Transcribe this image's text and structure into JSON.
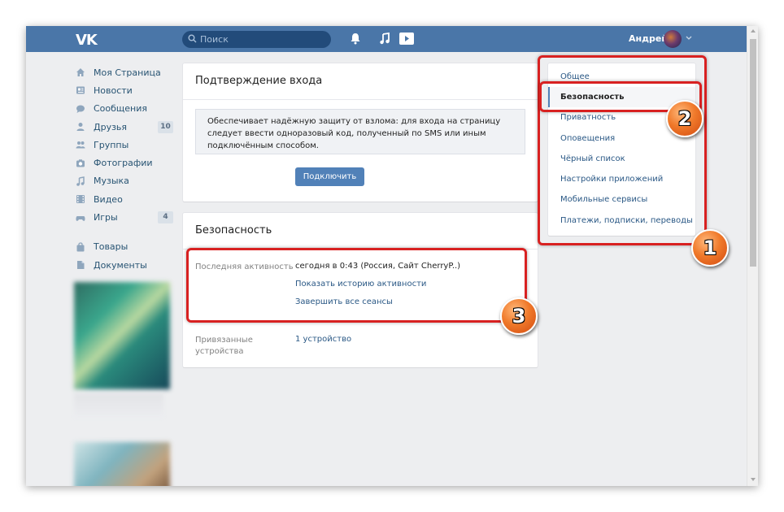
{
  "header": {
    "logo": "VK",
    "search_placeholder": "Поиск",
    "user_name": "Андрей"
  },
  "left_nav": [
    {
      "label": "Моя Страница",
      "icon": "home-icon"
    },
    {
      "label": "Новости",
      "icon": "news-icon"
    },
    {
      "label": "Сообщения",
      "icon": "messages-icon"
    },
    {
      "label": "Друзья",
      "icon": "friends-icon",
      "badge": "10"
    },
    {
      "label": "Группы",
      "icon": "groups-icon"
    },
    {
      "label": "Фотографии",
      "icon": "photos-icon"
    },
    {
      "label": "Музыка",
      "icon": "music-icon"
    },
    {
      "label": "Видео",
      "icon": "video-icon"
    },
    {
      "label": "Игры",
      "icon": "games-icon",
      "badge": "4"
    },
    {
      "label": "Товары",
      "icon": "market-icon"
    },
    {
      "label": "Документы",
      "icon": "documents-icon"
    }
  ],
  "login_confirmation": {
    "title": "Подтверждение входа",
    "description": "Обеспечивает надёжную защиту от взлома: для входа на страницу следует ввести одноразовый код, полученный по SMS или иным подключённым способом.",
    "connect_button": "Подключить"
  },
  "security": {
    "title": "Безопасность",
    "last_activity_label": "Последняя активность",
    "last_activity_value": "сегодня в 0:43 (Россия, Сайт CherryP..)",
    "show_history_link": "Показать историю активности",
    "end_sessions_link": "Завершить все сеансы",
    "devices_label": "Привязанные устройства",
    "devices_value": "1 устройство"
  },
  "settings_menu": [
    {
      "label": "Общее",
      "active": false
    },
    {
      "label": "Безопасность",
      "active": true
    },
    {
      "label": "Приватность",
      "active": false
    },
    {
      "label": "Оповещения",
      "active": false
    },
    {
      "label": "Чёрный список",
      "active": false
    },
    {
      "label": "Настройки приложений",
      "active": false
    },
    {
      "label": "Мобильные сервисы",
      "active": false
    },
    {
      "label": "Платежи, подписки, переводы",
      "active": false
    }
  ],
  "markers": [
    "1",
    "2",
    "3"
  ],
  "colors": {
    "header": "#4a76a8",
    "accent": "#5181b8",
    "link": "#2a5885",
    "highlight": "#d82121",
    "marker": "#f07a2b"
  }
}
